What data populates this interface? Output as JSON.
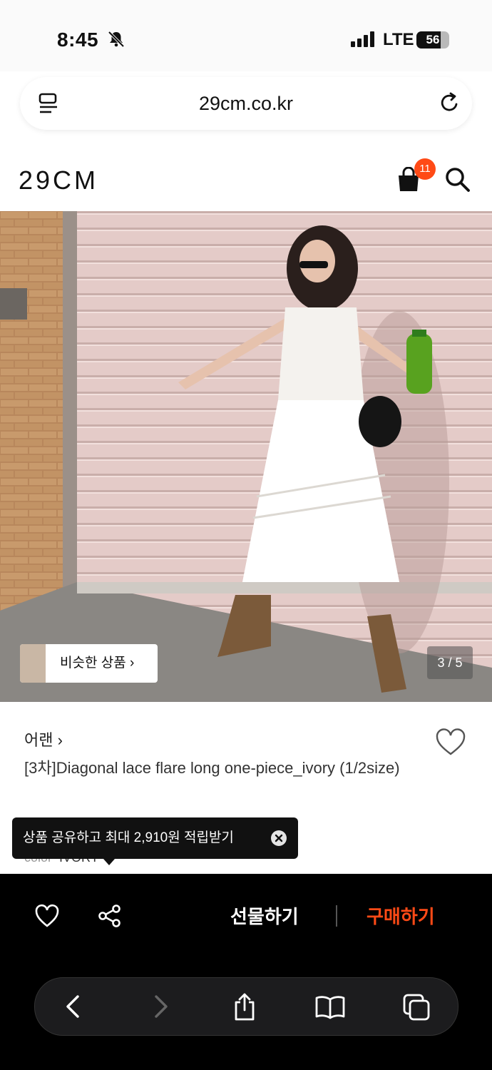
{
  "status": {
    "time": "8:45",
    "network": "LTE",
    "battery": "56"
  },
  "browser": {
    "url": "29cm.co.kr"
  },
  "site": {
    "logo": "29CM",
    "cart_count": "11"
  },
  "gallery": {
    "similar_label": "비슷한 상품 ›",
    "counter": "3 / 5"
  },
  "product": {
    "brand": "어랜 ›",
    "title": "[3차]Diagonal lace flare long one-piece_ivory (1/2size)",
    "color_label": "color",
    "color_value": "IVORY"
  },
  "tooltip": {
    "text": "상품 공유하고 최대 2,910원 적립받기"
  },
  "actions": {
    "gift": "선물하기",
    "buy": "구매하기"
  },
  "colors": {
    "accent": "#ff4a16",
    "bar": "#000000"
  },
  "icons": [
    "bell-slash-icon",
    "signal-icon",
    "battery-icon",
    "menu-icon",
    "reload-icon",
    "bag-icon",
    "search-icon",
    "heart-icon",
    "share-icon",
    "chevron-left-icon",
    "chevron-right-icon",
    "share-upload-icon",
    "book-icon",
    "tabs-icon"
  ]
}
